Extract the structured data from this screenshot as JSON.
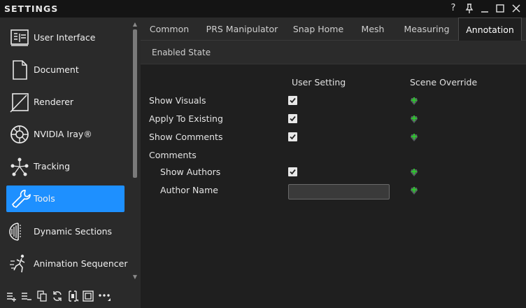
{
  "window": {
    "title": "SETTINGS",
    "buttons": {
      "help": "?",
      "pin": "pin-icon",
      "minimize": "_",
      "maximize": "□",
      "close": "✕"
    }
  },
  "sidebar": {
    "items": [
      {
        "label": "User Interface",
        "icon": "user-interface-icon",
        "active": false
      },
      {
        "label": "Document",
        "icon": "document-icon",
        "active": false
      },
      {
        "label": "Renderer",
        "icon": "renderer-icon",
        "active": false
      },
      {
        "label": "NVIDIA Iray®",
        "icon": "nvidia-iray-icon",
        "active": false
      },
      {
        "label": "Tracking",
        "icon": "tracking-icon",
        "active": false
      },
      {
        "label": "Tools",
        "icon": "tools-icon",
        "active": true
      },
      {
        "label": "Dynamic Sections",
        "icon": "dynamic-sections-icon",
        "active": false
      },
      {
        "label": "Animation Sequencer",
        "icon": "animation-sequencer-icon",
        "active": false
      }
    ],
    "toolbar": [
      "add-icon",
      "remove-icon",
      "copy-icon",
      "refresh-icon",
      "import-icon",
      "export-icon",
      "more-icon"
    ]
  },
  "tabs": [
    {
      "label": "Common",
      "active": false
    },
    {
      "label": "PRS Manipulator",
      "active": false
    },
    {
      "label": "Snap Home",
      "active": false
    },
    {
      "label": "Mesh",
      "active": false
    },
    {
      "label": "Measuring",
      "active": false
    },
    {
      "label": "Annotation",
      "active": true
    }
  ],
  "subbar": {
    "label": "Enabled State"
  },
  "settings": {
    "col_user": "User Setting",
    "col_scene": "Scene Override",
    "rows": {
      "show_visuals": {
        "label": "Show Visuals",
        "checked": true
      },
      "apply_existing": {
        "label": "Apply To Existing",
        "checked": true
      },
      "show_comments": {
        "label": "Show Comments",
        "checked": true
      },
      "comments": {
        "label": "Comments"
      },
      "show_authors": {
        "label": "Show Authors",
        "checked": true
      },
      "author_name": {
        "label": "Author Name",
        "value": "",
        "placeholder": ""
      }
    }
  },
  "colors": {
    "accent": "#1e90ff",
    "override_green": "#2ec22e"
  }
}
